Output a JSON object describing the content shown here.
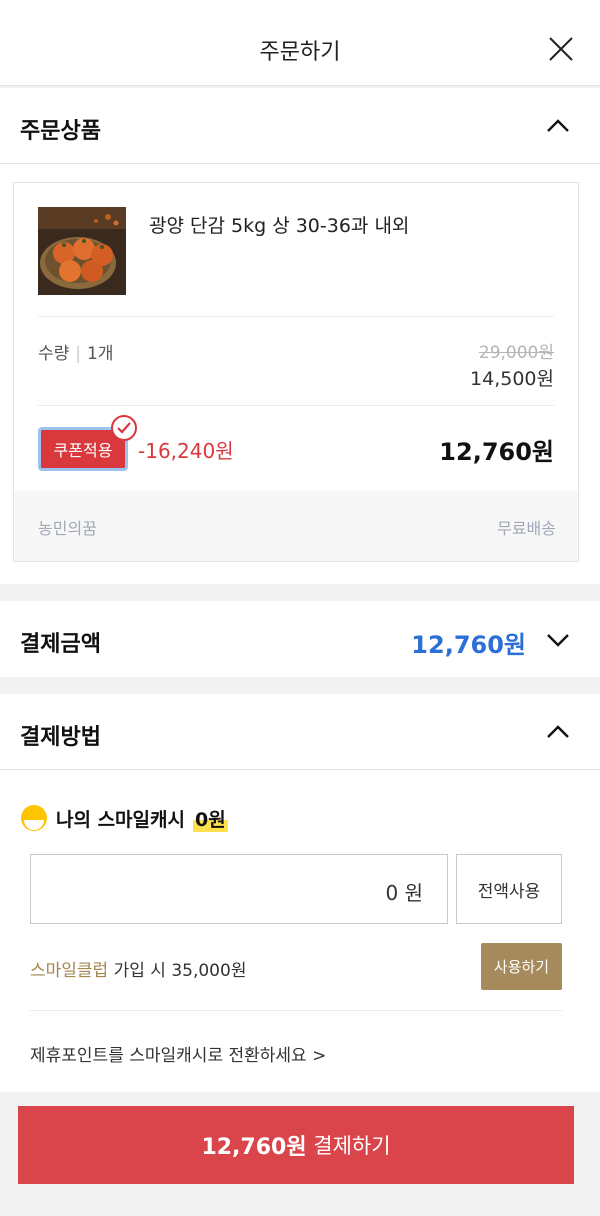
{
  "header": {
    "title": "주문하기"
  },
  "order_section": {
    "title": "주문상품"
  },
  "product": {
    "name": "광양 단감 5kg 상 30-36과 내외",
    "qty_label": "수량",
    "qty_value": "1개",
    "original_price": "29,000원",
    "sale_price": "14,500원",
    "coupon_label": "쿠폰적용",
    "discount": "-16,240원",
    "final_price": "12,760원",
    "seller": "농민의꿈",
    "delivery": "무료배송"
  },
  "payment_amount": {
    "label": "결제금액",
    "amount": "12,760원"
  },
  "payment_method": {
    "title": "결제방법",
    "cash_label": "나의 스마일캐시",
    "cash_value": "0원",
    "input_value": "0 원",
    "full_use_label": "전액사용",
    "club_name": "스마일클럽",
    "club_text": " 가입 시 35,000원",
    "use_label": "사용하기",
    "convert_text": "제휴포인트를 스마일캐시로 전환하세요 >"
  },
  "pay_button": {
    "amount": "12,760원",
    "label": " 결제하기"
  },
  "colors": {
    "accent_red": "#d9454a",
    "amount_blue": "#2c6fd6",
    "club_gold": "#a68a5b"
  }
}
